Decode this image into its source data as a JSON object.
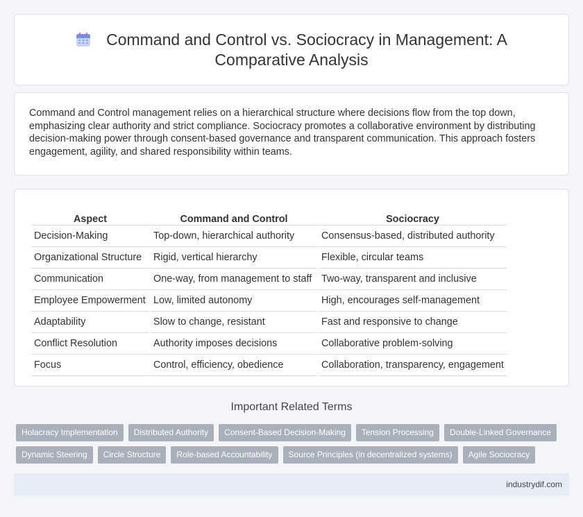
{
  "header": {
    "title": "Command and Control vs. Sociocracy in Management: A Comparative Analysis",
    "icon": "calendar-icon"
  },
  "intro": {
    "text": "Command and Control management relies on a hierarchical structure where decisions flow from the top down, emphasizing clear authority and strict compliance. Sociocracy promotes a collaborative environment by distributing decision-making power through consent-based governance and transparent communication. This approach fosters engagement, agility, and shared responsibility within teams."
  },
  "table": {
    "headers": [
      "Aspect",
      "Command and Control",
      "Sociocracy"
    ],
    "rows": [
      [
        "Decision-Making",
        "Top-down, hierarchical authority",
        "Consensus-based, distributed authority"
      ],
      [
        "Organizational Structure",
        "Rigid, vertical hierarchy",
        "Flexible, circular teams"
      ],
      [
        "Communication",
        "One-way, from management to staff",
        "Two-way, transparent and inclusive"
      ],
      [
        "Employee Empowerment",
        "Low, limited autonomy",
        "High, encourages self-management"
      ],
      [
        "Adaptability",
        "Slow to change, resistant",
        "Fast and responsive to change"
      ],
      [
        "Conflict Resolution",
        "Authority imposes decisions",
        "Collaborative problem-solving"
      ],
      [
        "Focus",
        "Control, efficiency, obedience",
        "Collaboration, transparency, engagement"
      ]
    ]
  },
  "related": {
    "title": "Important Related Terms",
    "tags": [
      "Holacracy Implementation",
      "Distributed Authority",
      "Consent-Based Decision-Making",
      "Tension Processing",
      "Double-Linked Governance",
      "Dynamic Steering",
      "Circle Structure",
      "Role-based Accountability",
      "Source Principles (in decentralized systems)",
      "Agile Sociocracy"
    ]
  },
  "footer": {
    "site": "industrydif.com"
  },
  "colors": {
    "background": "#f3f5f9",
    "tag_bg": "#a9b0bb",
    "footer_bg": "#e6ecf5"
  }
}
